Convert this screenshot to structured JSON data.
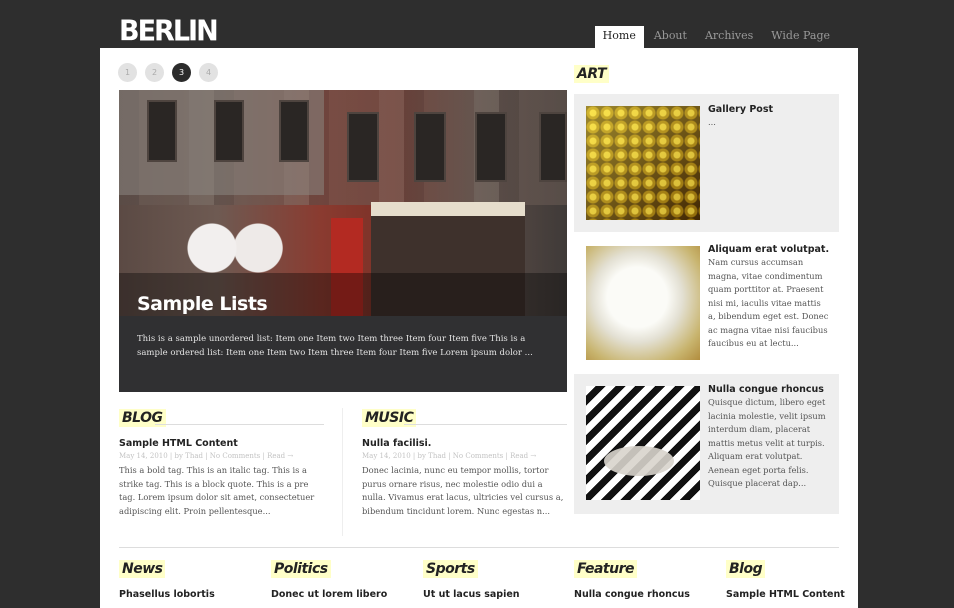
{
  "site": {
    "logo": "BERLIN"
  },
  "nav": [
    {
      "label": "Home",
      "active": true
    },
    {
      "label": "About"
    },
    {
      "label": "Archives"
    },
    {
      "label": "Wide Page"
    }
  ],
  "slider": {
    "dots": [
      "1",
      "2",
      "3",
      "4"
    ],
    "active_index": 2,
    "title": "Sample Lists",
    "excerpt": "This is a sample unordered list: Item one Item two Item three Item four Item five This is a sample ordered list: Item one Item two Item three Item four Item five Lorem ipsum dolor ..."
  },
  "blog": {
    "title": "BLOG",
    "post": {
      "title": "Sample HTML Content",
      "meta": "May 14, 2010 | by Thad | No Comments | Read →",
      "excerpt": "This a bold tag. This is an italic tag. This is a strike tag. This is a block quote. This is a pre tag. Lorem ipsum dolor sit amet, consectetuer adipiscing elit. Proin pellentesque..."
    }
  },
  "music": {
    "title": "MUSIC",
    "post": {
      "title": "Nulla facilisi.",
      "meta": "May 14, 2010 | by Thad | No Comments | Read →",
      "excerpt": "Donec lacinia, nunc eu tempor mollis, tortor purus ornare risus, nec molestie odio dui a nulla. Vivamus erat lacus, ultricies vel cursus a, bibendum tincidunt lorem. Nunc egestas n..."
    }
  },
  "art": {
    "title": "ART",
    "items": [
      {
        "title": "Gallery Post",
        "excerpt": "..."
      },
      {
        "title": "Aliquam erat volutpat.",
        "excerpt": "Nam cursus accumsan magna, vitae condimentum quam porttitor at. Praesent nisi mi, iaculis vitae mattis a, bibendum eget est. Donec ac magna vitae nisi faucibus faucibus eu at lectu..."
      },
      {
        "title": "Nulla congue rhoncus",
        "excerpt": "Quisque dictum, libero eget lacinia molestie, velit ipsum interdum diam, placerat mattis metus velit at turpis. Aliquam erat volutpat. Aenean eget porta felis. Quisque placerat dap..."
      }
    ]
  },
  "bottom": [
    {
      "title": "News",
      "post_title": "Phasellus lobortis"
    },
    {
      "title": "Politics",
      "post_title": "Donec ut lorem libero"
    },
    {
      "title": "Sports",
      "post_title": "Ut ut lacus sapien"
    },
    {
      "title": "Feature",
      "post_title": "Nulla congue rhoncus"
    },
    {
      "title": "Blog",
      "post_title": "Sample HTML Content"
    }
  ]
}
